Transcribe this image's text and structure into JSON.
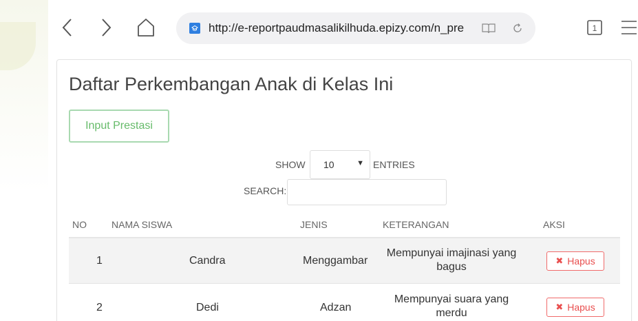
{
  "browser": {
    "url": "http://e-reportpaudmasalikilhuda.epizy.com/n_pre",
    "tab_count": "1"
  },
  "page": {
    "title": "Daftar Perkembangan Anak di Kelas Ini",
    "input_button": "Input Prestasi",
    "show_label": "SHOW",
    "show_value": "10",
    "entries_label": "ENTRIES",
    "search_label": "SEARCH:",
    "search_value": ""
  },
  "table": {
    "headers": [
      "NO",
      "NAMA SISWA",
      "JENIS",
      "KETERANGAN",
      "AKSI"
    ],
    "rows": [
      {
        "no": "1",
        "nama": "Candra",
        "jenis": "Menggambar",
        "keterangan": "Mempunyai imajinasi yang bagus",
        "aksi": "Hapus"
      },
      {
        "no": "2",
        "nama": "Dedi",
        "jenis": "Adzan",
        "keterangan": "Mempunyai suara yang merdu",
        "aksi": "Hapus"
      }
    ]
  },
  "colors": {
    "success_outline": "#a8d9b0",
    "success_text": "#66bb6a",
    "danger": "#e94e4e",
    "url_bar_bg": "#f1f1f3",
    "favicon": "#2f7fe0"
  },
  "icons": [
    "back-icon",
    "forward-icon",
    "home-icon",
    "favicon-icon",
    "reader-icon",
    "reload-icon",
    "tabs-icon",
    "menu-icon",
    "close-x-icon"
  ]
}
